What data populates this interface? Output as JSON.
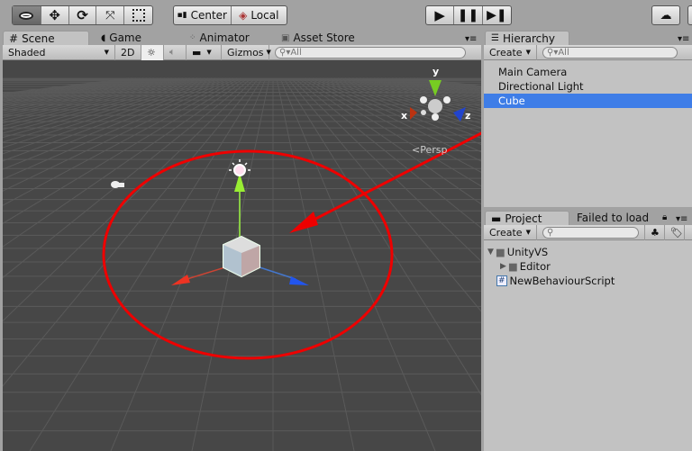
{
  "toolbar": {
    "tools": [
      "view-icon",
      "move-icon",
      "rotate-icon",
      "scale-icon",
      "rect-icon"
    ],
    "pivot": "Center",
    "space": "Local",
    "play": [
      "play-icon",
      "pause-icon",
      "step-icon"
    ]
  },
  "scene_tabs": [
    {
      "label": "Scene",
      "icon": "grid-icon"
    },
    {
      "label": "Game",
      "icon": "pacman-icon"
    },
    {
      "label": "Animator",
      "icon": "animator-icon"
    },
    {
      "label": "Asset Store",
      "icon": "store-icon"
    }
  ],
  "scene_bar": {
    "shading": "Shaded",
    "mode_2d": "2D",
    "gizmos": "Gizmos",
    "search_placeholder": "All"
  },
  "scene": {
    "projection": "Persp",
    "axes": {
      "x": "x",
      "y": "y",
      "z": "z"
    }
  },
  "hierarchy": {
    "title": "Hierarchy",
    "create": "Create",
    "search_placeholder": "All",
    "items": [
      {
        "label": "Main Camera",
        "selected": false
      },
      {
        "label": "Directional Light",
        "selected": false
      },
      {
        "label": "Cube",
        "selected": true
      }
    ]
  },
  "project": {
    "title": "Project",
    "tab2": "Failed to load",
    "create": "Create",
    "items": [
      {
        "label": "UnityVS",
        "type": "folder",
        "expanded": true
      },
      {
        "label": "Editor",
        "type": "folder",
        "expanded": false
      },
      {
        "label": "NewBehaviourScript",
        "type": "csharp-script"
      }
    ]
  },
  "colors": {
    "selection": "#3e7de7",
    "annotation": "#e00000",
    "scene_bg": "#474747"
  }
}
